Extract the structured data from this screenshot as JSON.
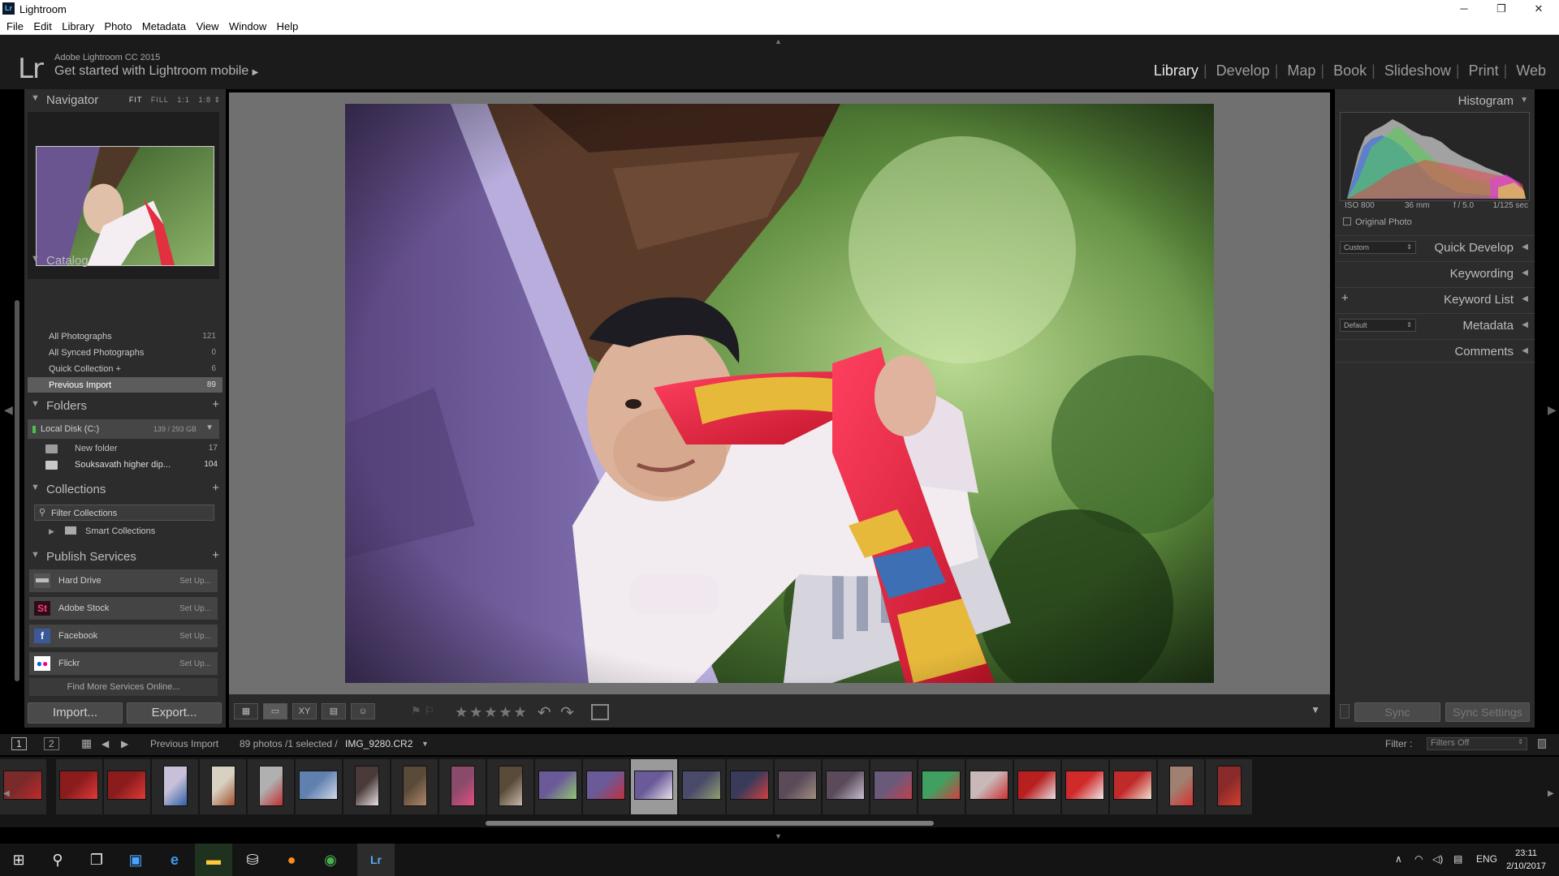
{
  "window": {
    "title": "Lightroom",
    "min": "─",
    "max": "❐",
    "close": "✕"
  },
  "menu": [
    "File",
    "Edit",
    "Library",
    "Photo",
    "Metadata",
    "View",
    "Window",
    "Help"
  ],
  "identity": {
    "logo": "Lr",
    "product": "Adobe Lightroom CC 2015",
    "mobile_label": "Get started with Lightroom mobile",
    "mobile_arrow": "▶"
  },
  "modules": [
    "Library",
    "Develop",
    "Map",
    "Book",
    "Slideshow",
    "Print",
    "Web"
  ],
  "active_module": "Library",
  "module_separator": "|",
  "navigator": {
    "title": "Navigator",
    "opts": [
      "FIT",
      "FILL",
      "1:1",
      "1:8"
    ],
    "active_opt": "FIT"
  },
  "catalog": {
    "title": "Catalog",
    "items": [
      {
        "name": "All Photographs",
        "count": "121"
      },
      {
        "name": "All Synced Photographs",
        "count": "0"
      },
      {
        "name": "Quick Collection +",
        "count": "6"
      },
      {
        "name": "Previous Import",
        "count": "89"
      }
    ]
  },
  "folders": {
    "title": "Folders",
    "disk": {
      "name": "Local Disk (C:)",
      "usage": "139 / 293 GB"
    },
    "items": [
      {
        "name": "New folder",
        "count": "17"
      },
      {
        "name": "Souksavath higher dip...",
        "count": "104"
      }
    ]
  },
  "collections": {
    "title": "Collections",
    "filter_label": "Filter Collections",
    "smart": "Smart Collections"
  },
  "publish": {
    "title": "Publish Services",
    "services": [
      {
        "name": "Hard Drive",
        "action": "Set Up...",
        "icon": "hard-drive-icon",
        "color": "#cfcfcf"
      },
      {
        "name": "Adobe Stock",
        "action": "Set Up...",
        "icon": "adobe-stock-icon",
        "color": "#d6185f"
      },
      {
        "name": "Facebook",
        "action": "Set Up...",
        "icon": "facebook-icon",
        "color": "#3b5998"
      },
      {
        "name": "Flickr",
        "action": "Set Up...",
        "icon": "flickr-icon",
        "color": "#ffffff"
      }
    ],
    "find_more": "Find More Services Online..."
  },
  "left_buttons": {
    "import": "Import...",
    "export": "Export..."
  },
  "histogram": {
    "title": "Histogram",
    "iso": "ISO 800",
    "focal": "36 mm",
    "aperture": "f / 5.0",
    "shutter": "1/125 sec",
    "original_photo": "Original Photo"
  },
  "right_sections": [
    {
      "title": "Quick Develop",
      "select": "Custom"
    },
    {
      "title": "Keywording"
    },
    {
      "title": "Keyword List"
    },
    {
      "title": "Metadata",
      "select": "Default"
    },
    {
      "title": "Comments"
    }
  ],
  "sync": {
    "sync": "Sync",
    "sync_settings": "Sync Settings"
  },
  "filmstrip": {
    "page1": "1",
    "page2": "2",
    "source": "Previous Import",
    "status": "89 photos /1 selected /",
    "filename": "IMG_9280.CR2",
    "filter_label": "Filter :",
    "filter_value": "Filters Off",
    "selected_index": 13,
    "thumb_count": 26
  },
  "taskbar": {
    "lang": "ENG",
    "time": "23:11",
    "date": "2/10/2017"
  },
  "colors": {
    "panel": "#2c2c2c",
    "accent_module": "#e8e8e8",
    "center_bg": "#707070"
  }
}
